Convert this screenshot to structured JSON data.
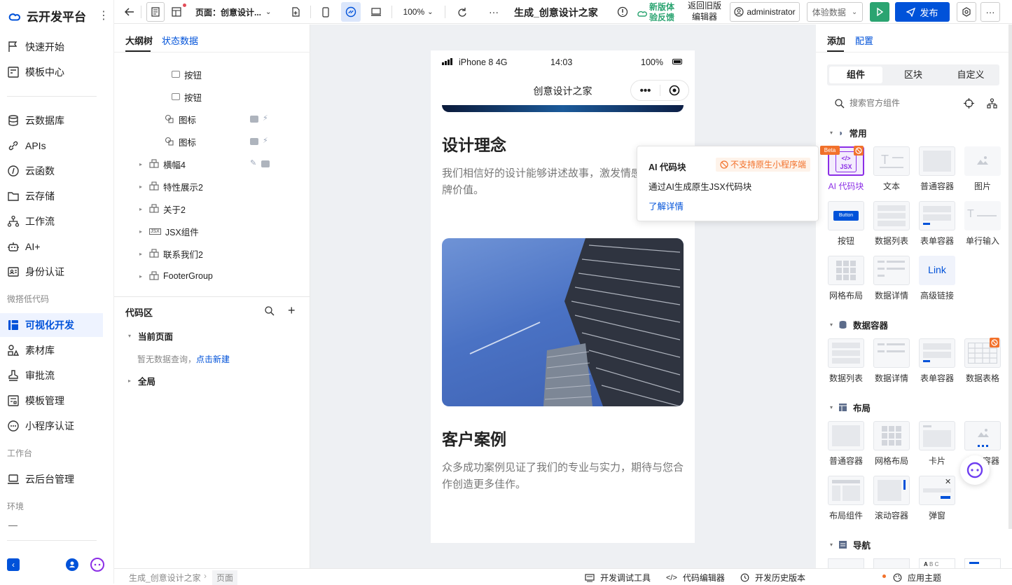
{
  "brand": {
    "name": "云开发平台"
  },
  "nav": {
    "items": [
      {
        "label": "快速开始"
      },
      {
        "label": "模板中心"
      },
      {
        "label": "云数据库"
      },
      {
        "label": "APIs"
      },
      {
        "label": "云函数"
      },
      {
        "label": "云存储"
      },
      {
        "label": "工作流"
      },
      {
        "label": "AI+"
      },
      {
        "label": "身份认证"
      },
      {
        "label": "可视化开发"
      },
      {
        "label": "素材库"
      },
      {
        "label": "审批流"
      },
      {
        "label": "模板管理"
      },
      {
        "label": "小程序认证"
      },
      {
        "label": "云后台管理"
      }
    ],
    "sections": {
      "lowcode": "微搭低代码",
      "workbench": "工作台",
      "env": "环境"
    },
    "env_value": "—"
  },
  "toolbar": {
    "page_select": "页面：创意设计...",
    "zoom": "100%",
    "more": "···",
    "app_title": "生成_创意设计之家",
    "feedback": "新版体验反馈",
    "back_old": "返回旧版编辑器",
    "user": "administrator",
    "data_select": "体验数据",
    "publish": "发布"
  },
  "outline": {
    "tabs": [
      "大纲树",
      "状态数据"
    ],
    "nodes": [
      {
        "label": "按钮"
      },
      {
        "label": "按钮"
      },
      {
        "label": "图标"
      },
      {
        "label": "图标"
      },
      {
        "label": "横幅4"
      },
      {
        "label": "特性展示2"
      },
      {
        "label": "关于2"
      },
      {
        "label": "JSX组件"
      },
      {
        "label": "联系我们2"
      },
      {
        "label": "FooterGroup"
      }
    ],
    "code_title": "代码区",
    "current_page": "当前页面",
    "empty_text": "暂无数据查询，",
    "create_link": "点击新建",
    "global": "全局"
  },
  "phone": {
    "carrier": "iPhone 8  4G",
    "time": "14:03",
    "battery": "100%",
    "title": "创意设计之家",
    "section1_title": "设计理念",
    "section1_text": "我们相信好的设计能够讲述故事，激发情感，传递品牌价值。",
    "section2_title": "客户案例",
    "section2_text": "众多成功案例见证了我们的专业与实力，期待与您合作创造更多佳作。"
  },
  "right": {
    "tabs": [
      "添加",
      "配置"
    ],
    "seg": [
      "组件",
      "区块",
      "自定义"
    ],
    "search_placeholder": "搜索官方组件",
    "groups": {
      "common": "常用",
      "data": "数据容器",
      "layout": "布局",
      "nav": "导航"
    },
    "common": [
      "AI 代码块",
      "文本",
      "普通容器",
      "图片",
      "按钮",
      "数据列表",
      "表单容器",
      "单行输入",
      "网格布局",
      "数据详情",
      "高级链接"
    ],
    "data": [
      "数据列表",
      "数据详情",
      "表单容器",
      "数据表格"
    ],
    "layout": [
      "普通容器",
      "网格布局",
      "卡片",
      "分页容器",
      "布局组件",
      "滚动容器",
      "弹窗"
    ],
    "beta": "Beta",
    "jsx_text": "JSX",
    "button_text": "Button",
    "link_text": "Link"
  },
  "popup": {
    "title": "AI 代码块",
    "tag": "不支持原生小程序端",
    "desc": "通过AI生成原生JSX代码块",
    "link": "了解详情"
  },
  "bottom": {
    "crumb1": "生成_创意设计之家",
    "crumb2": "页面",
    "debug": "开发调试工具",
    "code_editor": "代码编辑器",
    "history": "开发历史版本",
    "theme": "应用主题"
  },
  "colors": {
    "accent": "#0052d9",
    "green": "#2ba471",
    "purple": "#8b2ee6",
    "orange": "#f2712b"
  }
}
